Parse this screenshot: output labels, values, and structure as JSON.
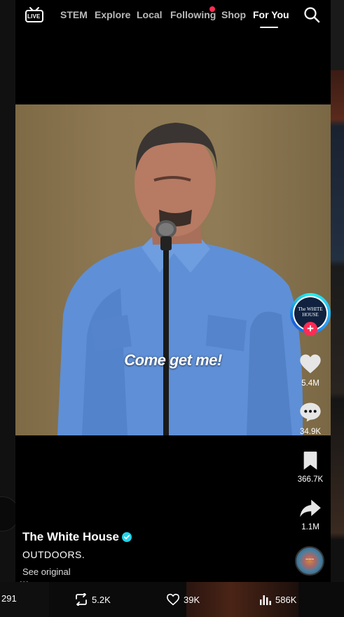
{
  "nav": {
    "live_label": "LIVE",
    "tabs": [
      {
        "label": "STEM"
      },
      {
        "label": "Explore"
      },
      {
        "label": "Local"
      },
      {
        "label": "Following"
      },
      {
        "label": "Shop"
      },
      {
        "label": "For You"
      }
    ],
    "active_tab": "For You"
  },
  "video": {
    "caption_overlay": "Come get me!"
  },
  "actions": {
    "avatar_text": "The WHITE HOUSE",
    "likes": "5.4M",
    "comments": "34.9K",
    "saves": "366.7K",
    "shares": "1.1M"
  },
  "post": {
    "author": "The White House",
    "description": "OUTDOORS.",
    "see_original": "See original"
  },
  "bottom_stats": {
    "left_count": "291",
    "reposts": "5.2K",
    "likes": "39K",
    "views": "586K"
  },
  "colors": {
    "accent": "#fe2c55",
    "verified": "#20d5ec"
  }
}
